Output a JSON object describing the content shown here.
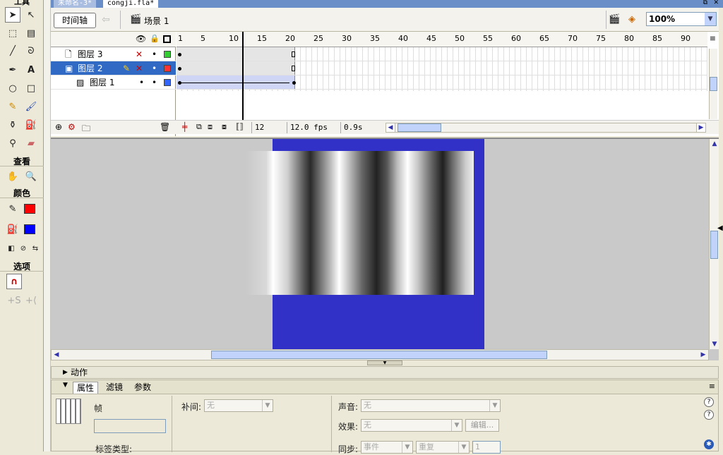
{
  "tabs": {
    "doc1": "未命名-3*",
    "doc2": "congji.fla*"
  },
  "toolbox": {
    "title": "工具",
    "view_label": "查看",
    "colors_label": "颜色",
    "options_label": "选项",
    "stroke_color": "#ff0000",
    "fill_color": "#0000ff"
  },
  "header": {
    "timeline_button": "时间轴",
    "scene_label": "场景 1",
    "zoom_value": "100%"
  },
  "timeline": {
    "ruler_ticks": [
      "1",
      "5",
      "10",
      "15",
      "20",
      "25",
      "30",
      "35",
      "40",
      "45",
      "50",
      "55",
      "60",
      "65",
      "70",
      "75",
      "80",
      "85",
      "90"
    ],
    "layers": [
      {
        "name": "图层 3",
        "color": "#33cc33"
      },
      {
        "name": "图层 2",
        "color": "#ff3333"
      },
      {
        "name": "图层 1",
        "color": "#3366ff"
      }
    ],
    "current_frame": "12",
    "fps": "12.0 fps",
    "time": "0.9s"
  },
  "stage": {
    "background": "#3131c8"
  },
  "actions_panel": {
    "label": "动作"
  },
  "properties": {
    "tab_properties": "属性",
    "tab_filters": "滤镜",
    "tab_params": "参数",
    "frame_label": "帧",
    "label_type": "标签类型:",
    "tween_label": "补间:",
    "tween_value": "无",
    "sound_label": "声音:",
    "sound_value": "无",
    "effect_label": "效果:",
    "effect_value": "无",
    "edit_button": "编辑...",
    "sync_label": "同步:",
    "sync_value": "事件",
    "repeat_value": "重复",
    "repeat_count": "1"
  }
}
